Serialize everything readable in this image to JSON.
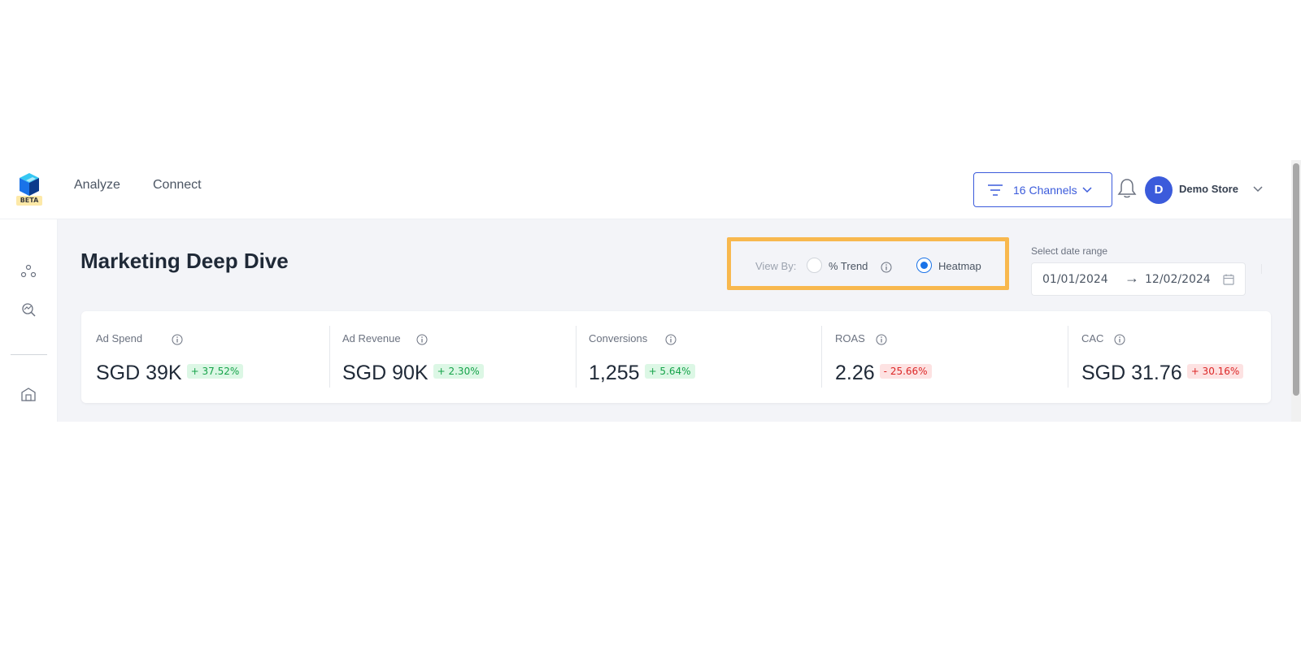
{
  "topnav": {
    "beta_badge": "BETA",
    "links": [
      "Analyze",
      "Connect"
    ],
    "channels_label": "16 Channels",
    "avatar_initial": "D",
    "store_name": "Demo Store"
  },
  "sidebar": {
    "icons": [
      "channels-icon",
      "search-analytics-icon",
      "store-icon"
    ]
  },
  "main": {
    "page_title": "Marketing Deep Dive",
    "view_by": {
      "label": "View By:",
      "options": [
        "% Trend",
        "Heatmap"
      ],
      "selected": "Heatmap"
    },
    "date": {
      "label": "Select date range",
      "start": "01/01/2024",
      "arrow": "→",
      "end": "12/02/2024"
    },
    "kpis": [
      {
        "label": "Ad Spend",
        "value": "SGD 39K",
        "change": "+ 37.52%",
        "direction": "up"
      },
      {
        "label": "Ad Revenue",
        "value": "SGD 90K",
        "change": "+ 2.30%",
        "direction": "up"
      },
      {
        "label": "Conversions",
        "value": "1,255",
        "change": "+ 5.64%",
        "direction": "up"
      },
      {
        "label": "ROAS",
        "value": "2.26",
        "change": "- 25.66%",
        "direction": "down"
      },
      {
        "label": "CAC",
        "value": "SGD 31.76",
        "change": "+ 30.16%",
        "direction": "down"
      }
    ]
  },
  "colors": {
    "accent": "#3b5bdb",
    "highlight_border": "#f8b84e",
    "positive": "#16a34a",
    "negative": "#dc2626",
    "background": "#f3f4f8"
  }
}
